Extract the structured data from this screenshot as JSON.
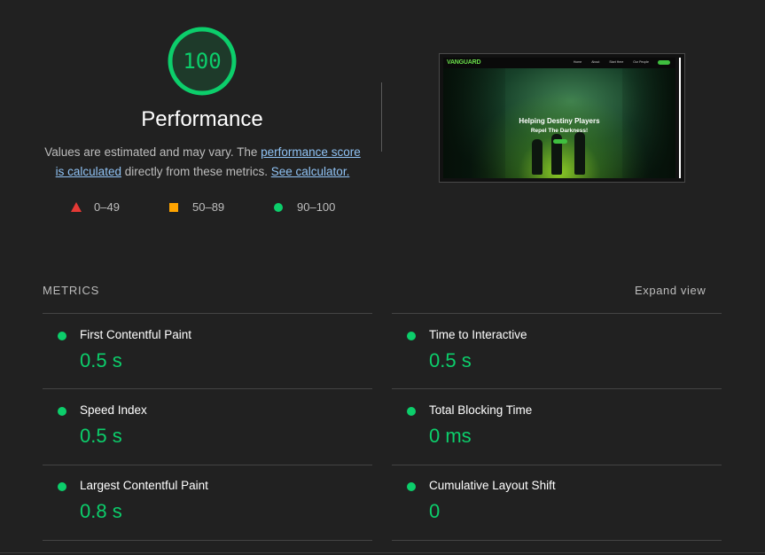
{
  "summary": {
    "score": "100",
    "score_fraction": 1.0,
    "title": "Performance",
    "desc_prefix": "Values are estimated and may vary. The ",
    "desc_link1": "performance score is calculated",
    "desc_middle": " directly from these metrics. ",
    "desc_link2": "See calculator.",
    "score_color": "#0cce6b"
  },
  "legend": [
    {
      "icon": "triangle-fail-icon",
      "range": "0–49",
      "color": "#e53935"
    },
    {
      "icon": "square-average-icon",
      "range": "50–89",
      "color": "#ffa400"
    },
    {
      "icon": "circle-pass-icon",
      "range": "90–100",
      "color": "#0cce6b"
    }
  ],
  "screenshot": {
    "logo": "VANGUARD",
    "nav_links": [
      "Home",
      "About",
      "Start Here",
      "Our People"
    ],
    "headline": "Helping Destiny Players",
    "subheadline": "Repel The Darkness!"
  },
  "metrics": {
    "header": "METRICS",
    "expand_label": "Expand view",
    "items": [
      {
        "title": "First Contentful Paint",
        "value": "0.5 s"
      },
      {
        "title": "Time to Interactive",
        "value": "0.5 s"
      },
      {
        "title": "Speed Index",
        "value": "0.5 s"
      },
      {
        "title": "Total Blocking Time",
        "value": "0 ms"
      },
      {
        "title": "Largest Contentful Paint",
        "value": "0.8 s"
      },
      {
        "title": "Cumulative Layout Shift",
        "value": "0"
      }
    ]
  }
}
